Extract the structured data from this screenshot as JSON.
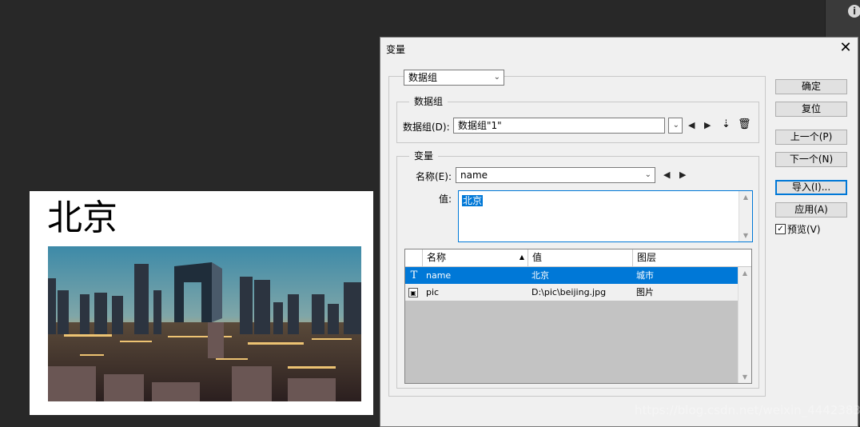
{
  "document": {
    "title": "北京",
    "photo": "city-skyline-photo"
  },
  "dialog": {
    "title": "变量",
    "close_label": "✕",
    "mode_select": "数据组",
    "dataset_group": {
      "legend": "数据组",
      "label": "数据组(D):",
      "value": "数据组\"1\""
    },
    "variables_group": {
      "legend": "变量",
      "name_label": "名称(E):",
      "name_value": "name",
      "value_label": "值:",
      "value_text": "北京"
    },
    "table": {
      "columns": [
        "名称",
        "值",
        "图层"
      ],
      "rows": [
        {
          "icon": "text-layer-icon",
          "name": "name",
          "value": "北京",
          "layer": "城市",
          "selected": true
        },
        {
          "icon": "image-layer-icon",
          "name": "pic",
          "value": "D:\\pic\\beijing.jpg",
          "layer": "图片",
          "selected": false
        }
      ]
    },
    "buttons": {
      "ok": "确定",
      "reset": "复位",
      "prev": "上一个(P)",
      "next": "下一个(N)",
      "import": "导入(I)...",
      "apply": "应用(A)"
    },
    "preview_label": "预览(V)",
    "preview_checked": true
  },
  "watermark": "https://blog.csdn.net/weixin_4442383",
  "colors": {
    "accent": "#0078d7",
    "workspace": "#282828",
    "dialog_bg": "#f0f0f0"
  }
}
